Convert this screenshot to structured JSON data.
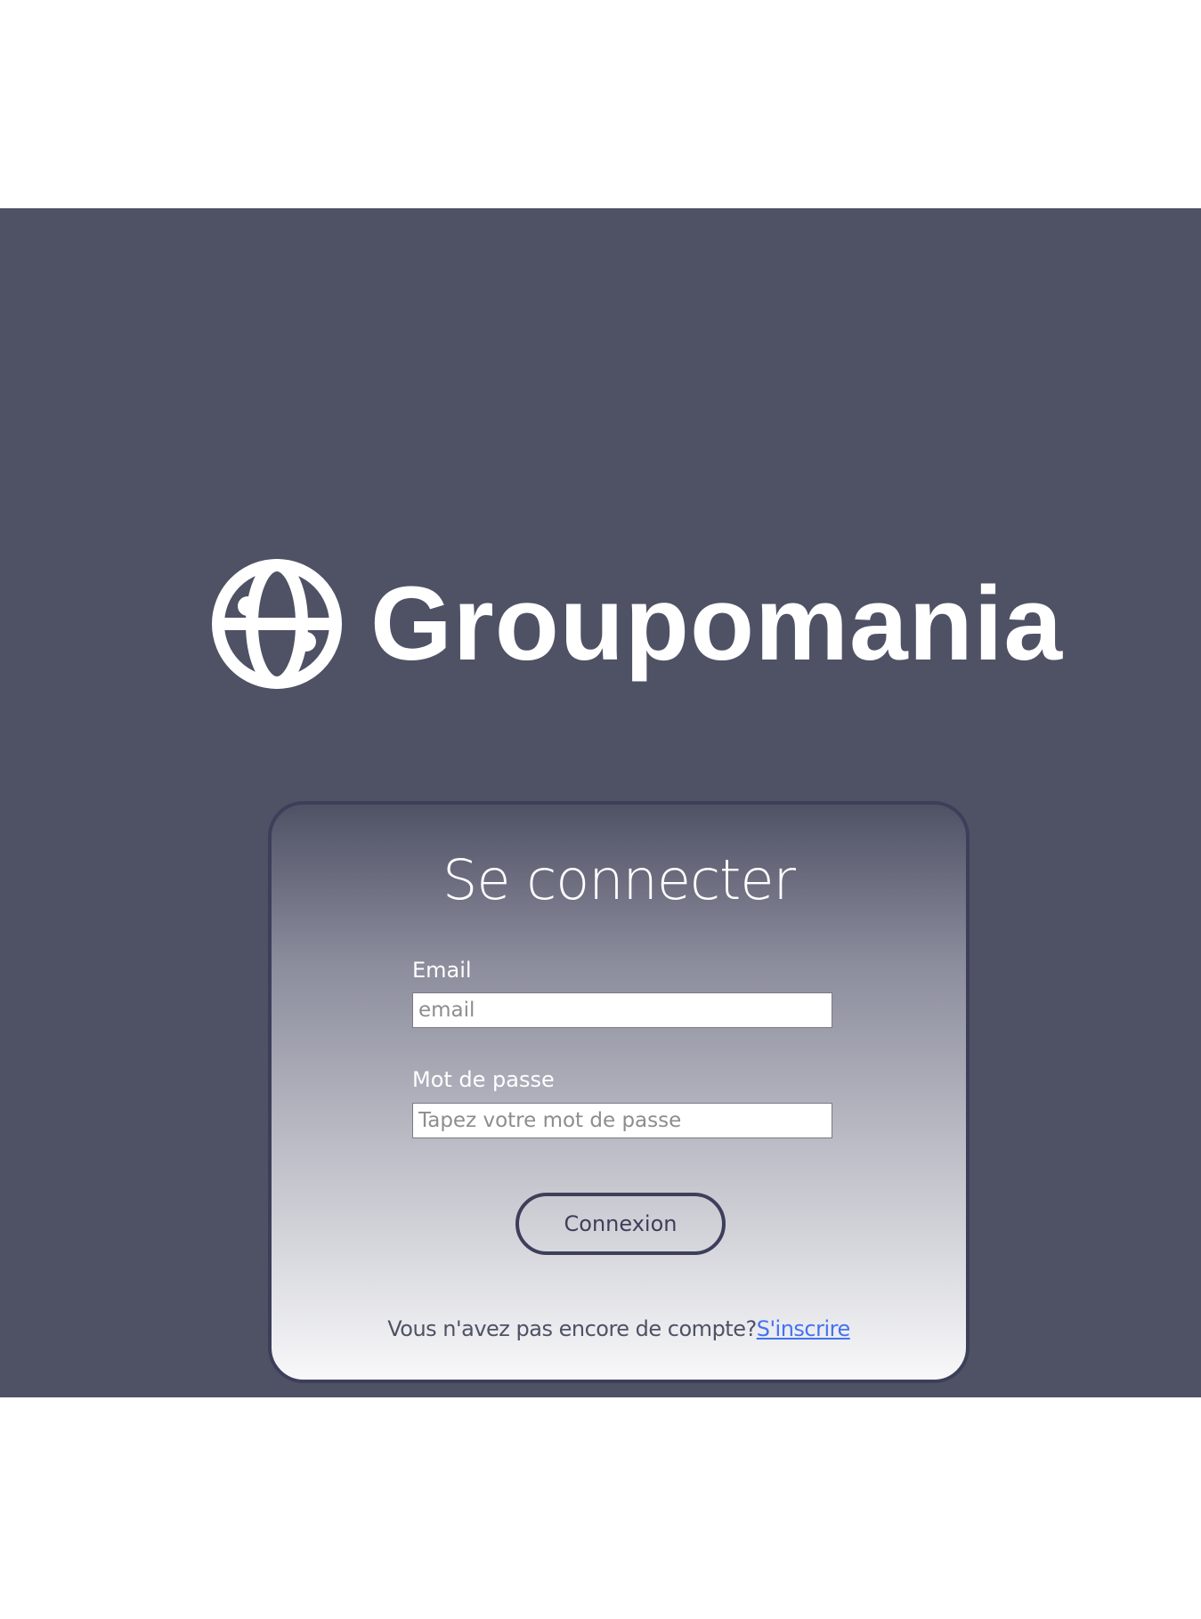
{
  "brand": {
    "name": "Groupomania",
    "icon": "globe-icon"
  },
  "login": {
    "title": "Se connecter",
    "email_label": "Email",
    "email_placeholder": "email",
    "email_value": "",
    "password_label": "Mot de passe",
    "password_placeholder": "Tapez votre mot de passe",
    "password_value": "",
    "submit_label": "Connexion",
    "signup_prompt": "Vous n'avez pas encore de compte?",
    "signup_link": "S'inscrire"
  },
  "colors": {
    "background_panel": "#4f5165",
    "card_border": "#3d3f5a",
    "link": "#4472f0",
    "text_light": "#ffffff"
  }
}
